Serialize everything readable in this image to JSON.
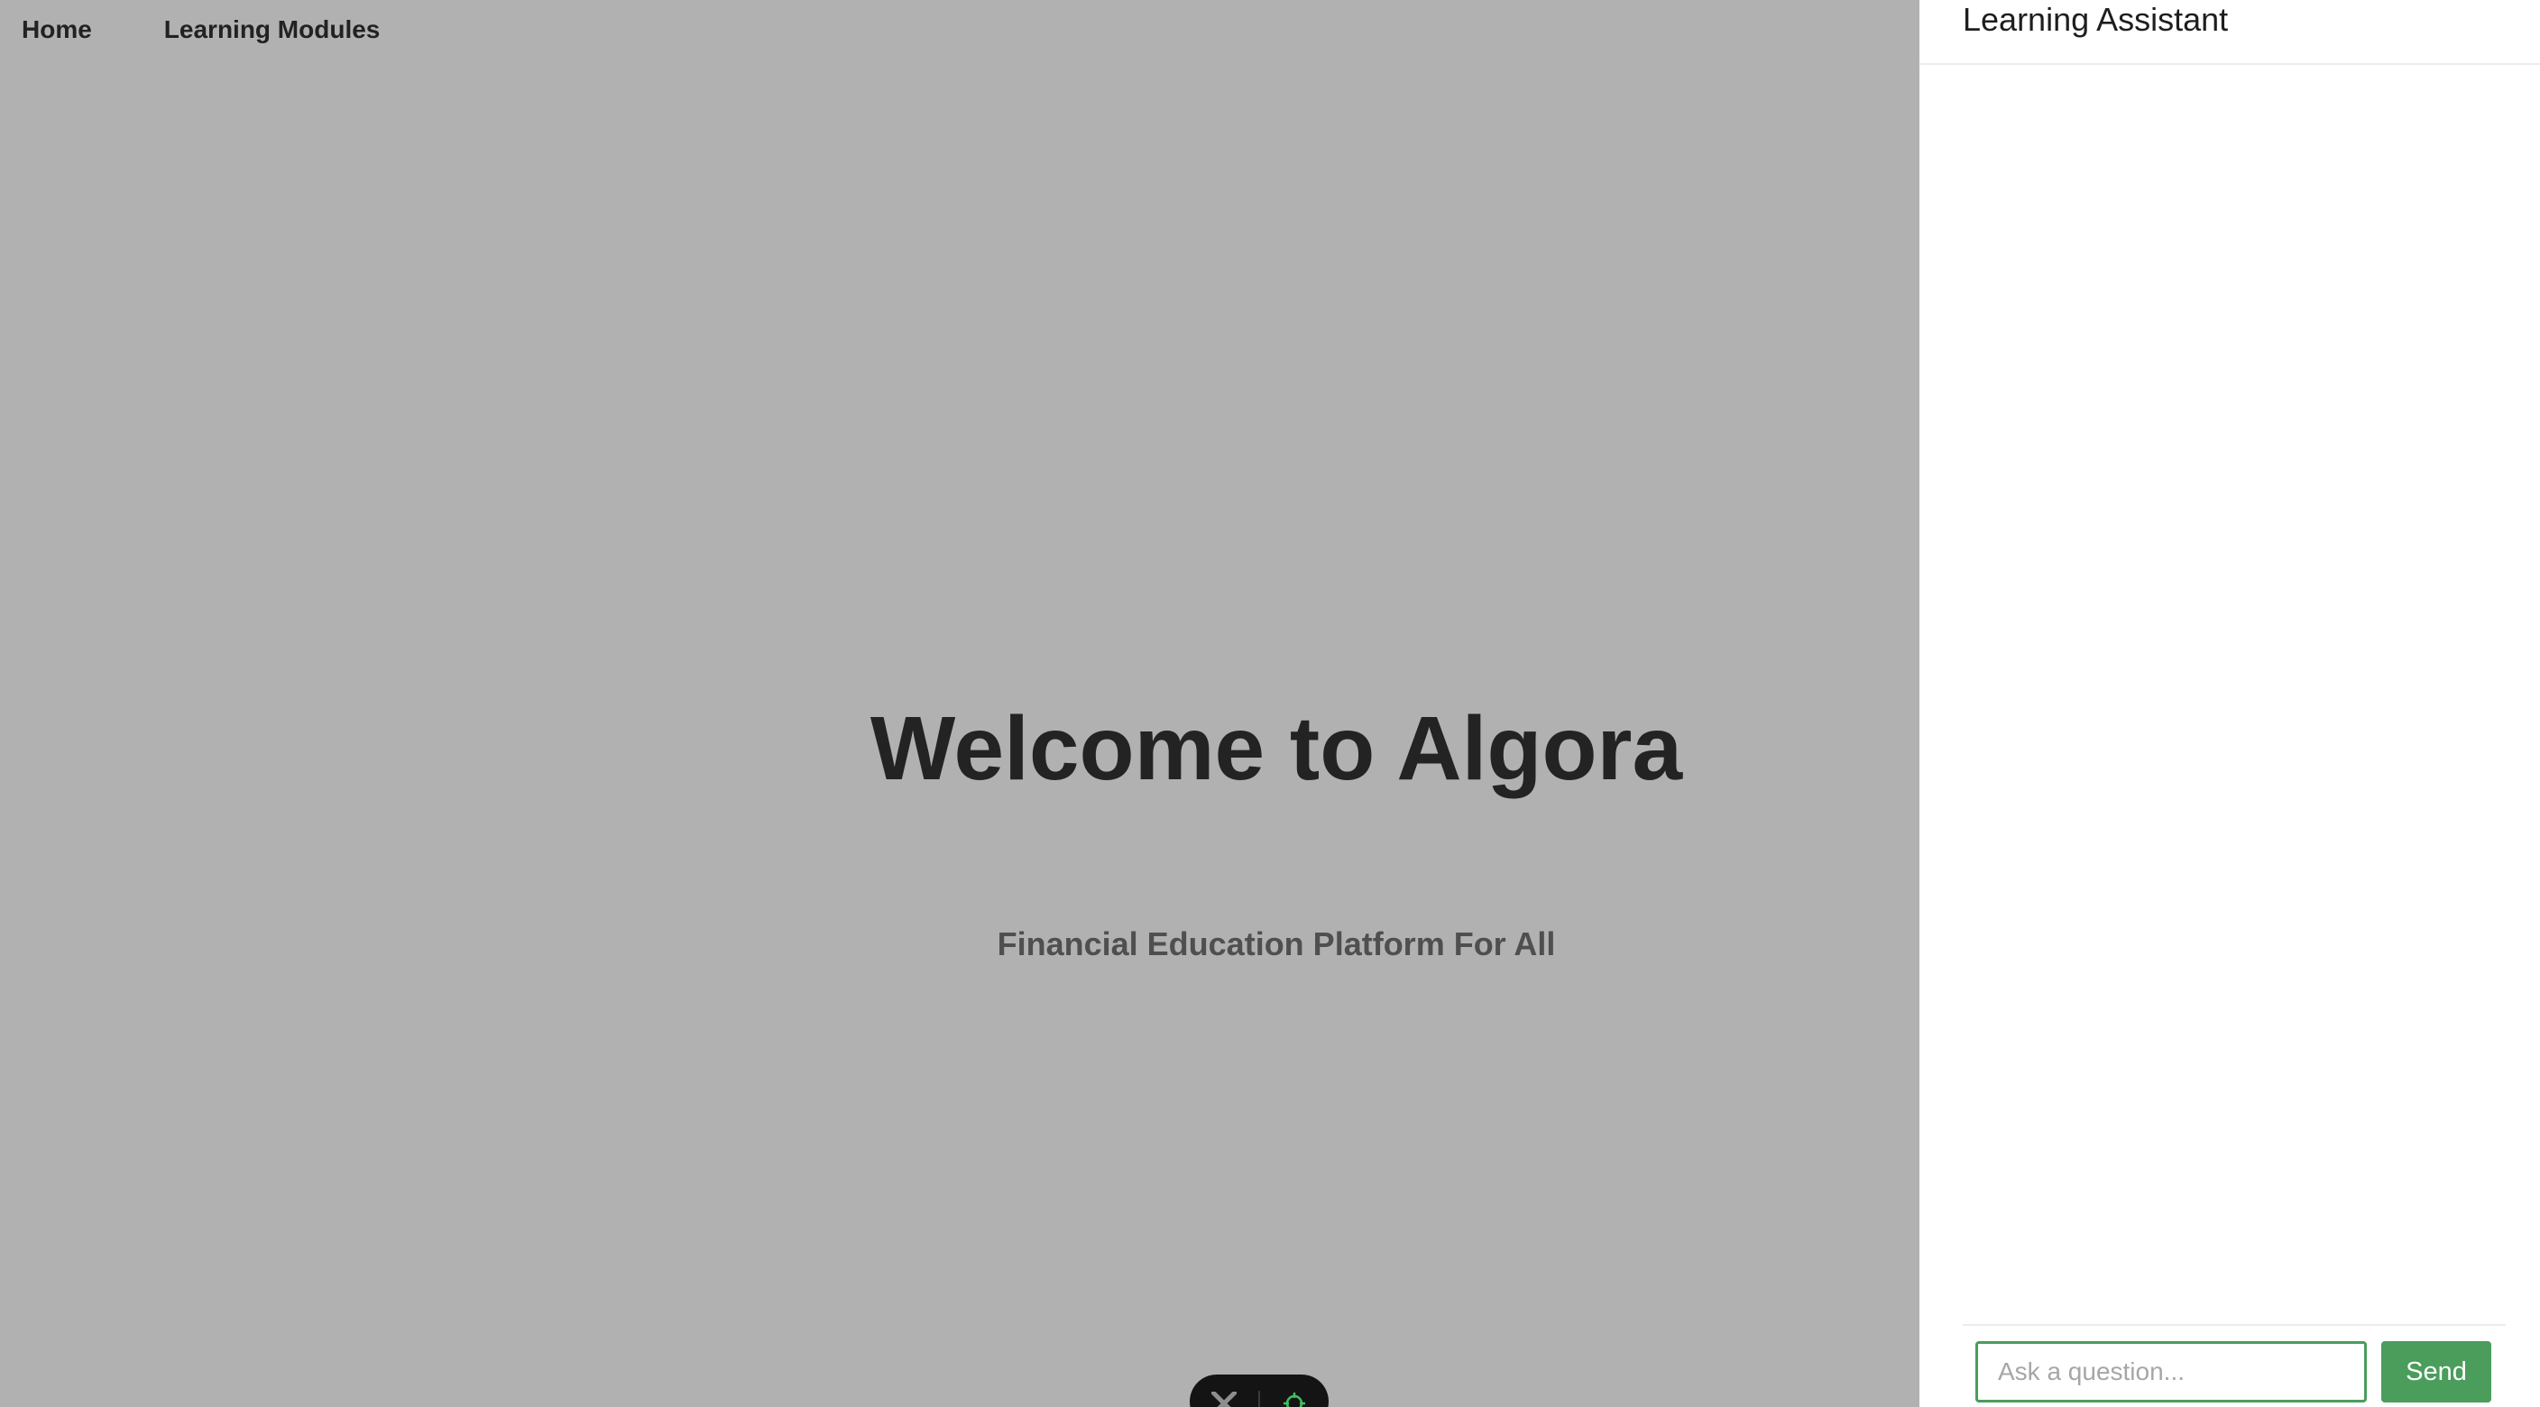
{
  "nav": {
    "items": [
      {
        "label": "Home"
      },
      {
        "label": "Learning Modules"
      }
    ]
  },
  "hero": {
    "title": "Welcome to Algora",
    "subtitle": "Financial Education Platform For All"
  },
  "assistant": {
    "title": "Learning Assistant",
    "input_placeholder": "Ask a question...",
    "input_value": "",
    "send_label": "Send"
  },
  "floating_toolbar": {
    "icons": [
      "x-logo-icon",
      "target-icon"
    ]
  },
  "colors": {
    "page_background": "#b1b1b1",
    "panel_background": "#ffffff",
    "accent_green": "#4a9d5b",
    "heading_text": "#232323",
    "subtitle_text": "#4f4f4f",
    "toolbar_background": "#141414"
  }
}
